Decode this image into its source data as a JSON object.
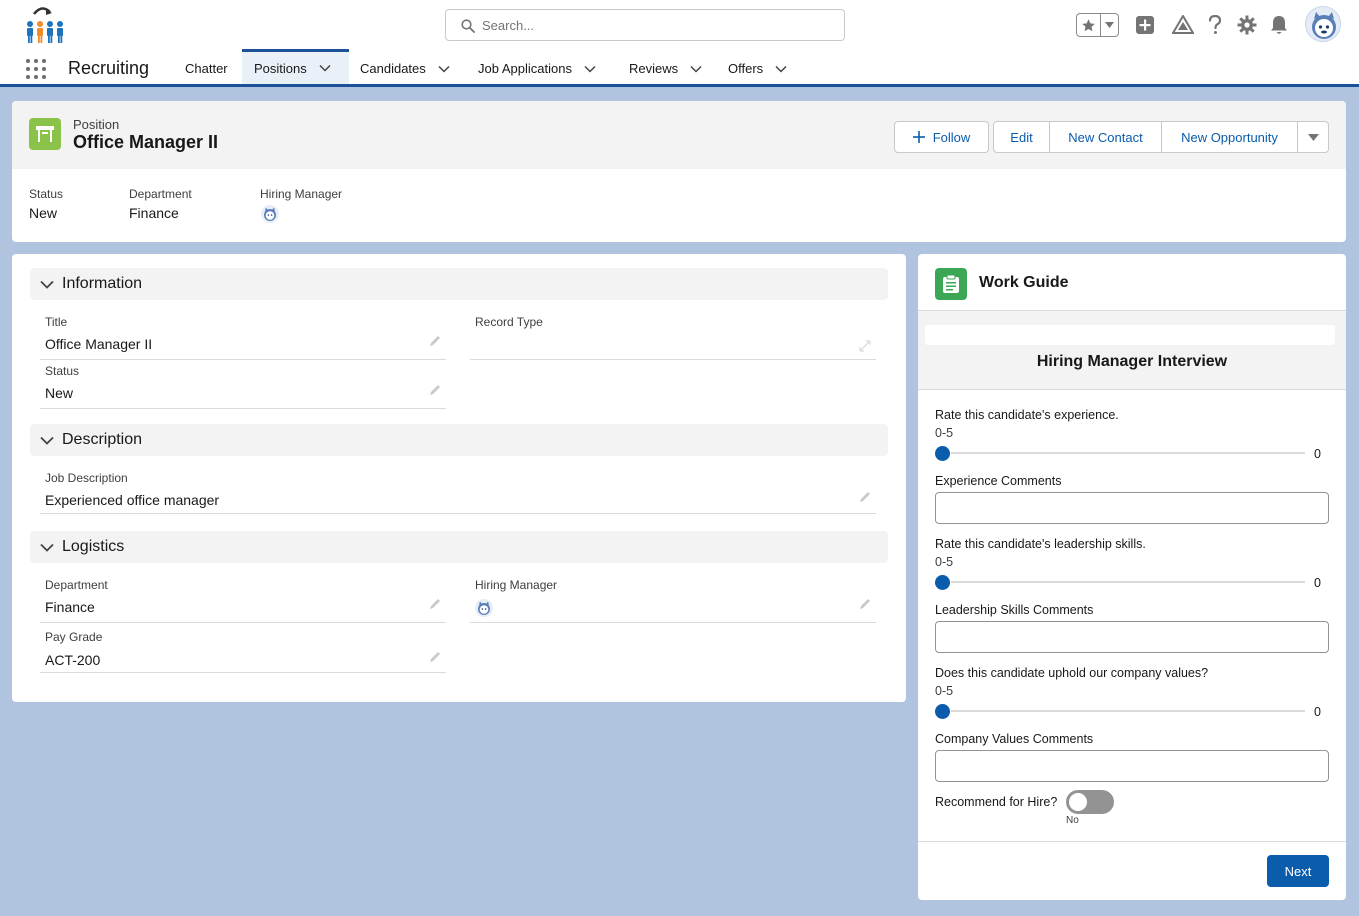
{
  "search": {
    "placeholder": "Search..."
  },
  "nav": {
    "app_name": "Recruiting",
    "tabs": [
      {
        "label": "Chatter"
      },
      {
        "label": "Positions"
      },
      {
        "label": "Candidates"
      },
      {
        "label": "Job Applications"
      },
      {
        "label": "Reviews"
      },
      {
        "label": "Offers"
      }
    ]
  },
  "record": {
    "object_type": "Position",
    "title": "Office Manager II",
    "actions": {
      "follow": "Follow",
      "edit": "Edit",
      "new_contact": "New Contact",
      "new_opportunity": "New Opportunity"
    },
    "highlights": [
      {
        "label": "Status",
        "value": "New"
      },
      {
        "label": "Department",
        "value": "Finance"
      },
      {
        "label": "Hiring Manager"
      }
    ]
  },
  "details": {
    "information": {
      "title": "Information",
      "title_label": "Title",
      "title_value": "Office Manager II",
      "record_type_label": "Record Type",
      "status_label": "Status",
      "status_value": "New"
    },
    "description": {
      "title": "Description",
      "job_description_label": "Job Description",
      "job_description_value": "Experienced office manager"
    },
    "logistics": {
      "title": "Logistics",
      "department_label": "Department",
      "department_value": "Finance",
      "hiring_manager_label": "Hiring Manager",
      "pay_grade_label": "Pay Grade",
      "pay_grade_value": "ACT-200"
    }
  },
  "work_guide": {
    "title": "Work Guide",
    "step_title": "Hiring Manager Interview",
    "questions": [
      {
        "question": "Rate this candidate's experience.",
        "range": "0-5",
        "value": 0,
        "comment_label": "Experience Comments"
      },
      {
        "question": "Rate this candidate's leadership skills.",
        "range": "0-5",
        "value": 0,
        "comment_label": "Leadership Skills Comments"
      },
      {
        "question": "Does this candidate uphold our company values?",
        "range": "0-5",
        "value": 0,
        "comment_label": "Company Values Comments"
      }
    ],
    "recommend_label": "Recommend for Hire?",
    "recommend_state": "No",
    "next_label": "Next"
  },
  "colors": {
    "brand": "#0b5cab",
    "nav_accent": "#1b5297",
    "position_icon": "#8bc34a",
    "work_guide_icon": "#3ba755",
    "page_background": "#b0c4df"
  },
  "icons": [
    "app-logo-icon",
    "search-icon",
    "favorites-star-icon",
    "add-icon",
    "trailhead-icon",
    "help-icon",
    "setup-gear-icon",
    "notifications-bell-icon",
    "user-avatar",
    "app-launcher-icon",
    "chevron-down-icon",
    "position-object-icon",
    "plus-icon",
    "pencil-icon",
    "work-guide-clipboard-icon"
  ]
}
